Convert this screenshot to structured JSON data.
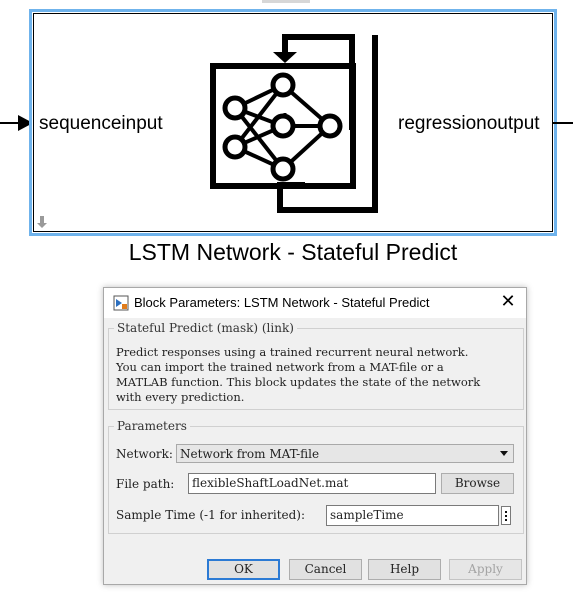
{
  "block": {
    "input_port": "sequenceinput",
    "output_port": "regressionoutput",
    "name": "LSTM Network - Stateful Predict"
  },
  "dialog": {
    "title": "Block Parameters: LSTM Network - Stateful Predict",
    "mask_header": "Stateful Predict (mask) (link)",
    "description_lines": [
      "Predict responses using a trained recurrent neural network.",
      "You can import the trained network from a MAT-file or a",
      "MATLAB function. This block updates the state of the network",
      "with every prediction."
    ],
    "parameters_header": "Parameters",
    "network_label": "Network:",
    "network_value": "Network from MAT-file",
    "filepath_label": "File path:",
    "filepath_value": "flexibleShaftLoadNet.mat",
    "browse_label": "Browse",
    "sampletime_label": "Sample Time (-1 for inherited):",
    "sampletime_value": "sampleTime",
    "buttons": {
      "ok": "OK",
      "cancel": "Cancel",
      "help": "Help",
      "apply": "Apply"
    }
  },
  "colors": {
    "selection_outline": "#6fb3ec",
    "dialog_bg": "#f0f0f0",
    "default_button_border": "#2b7ad4"
  }
}
